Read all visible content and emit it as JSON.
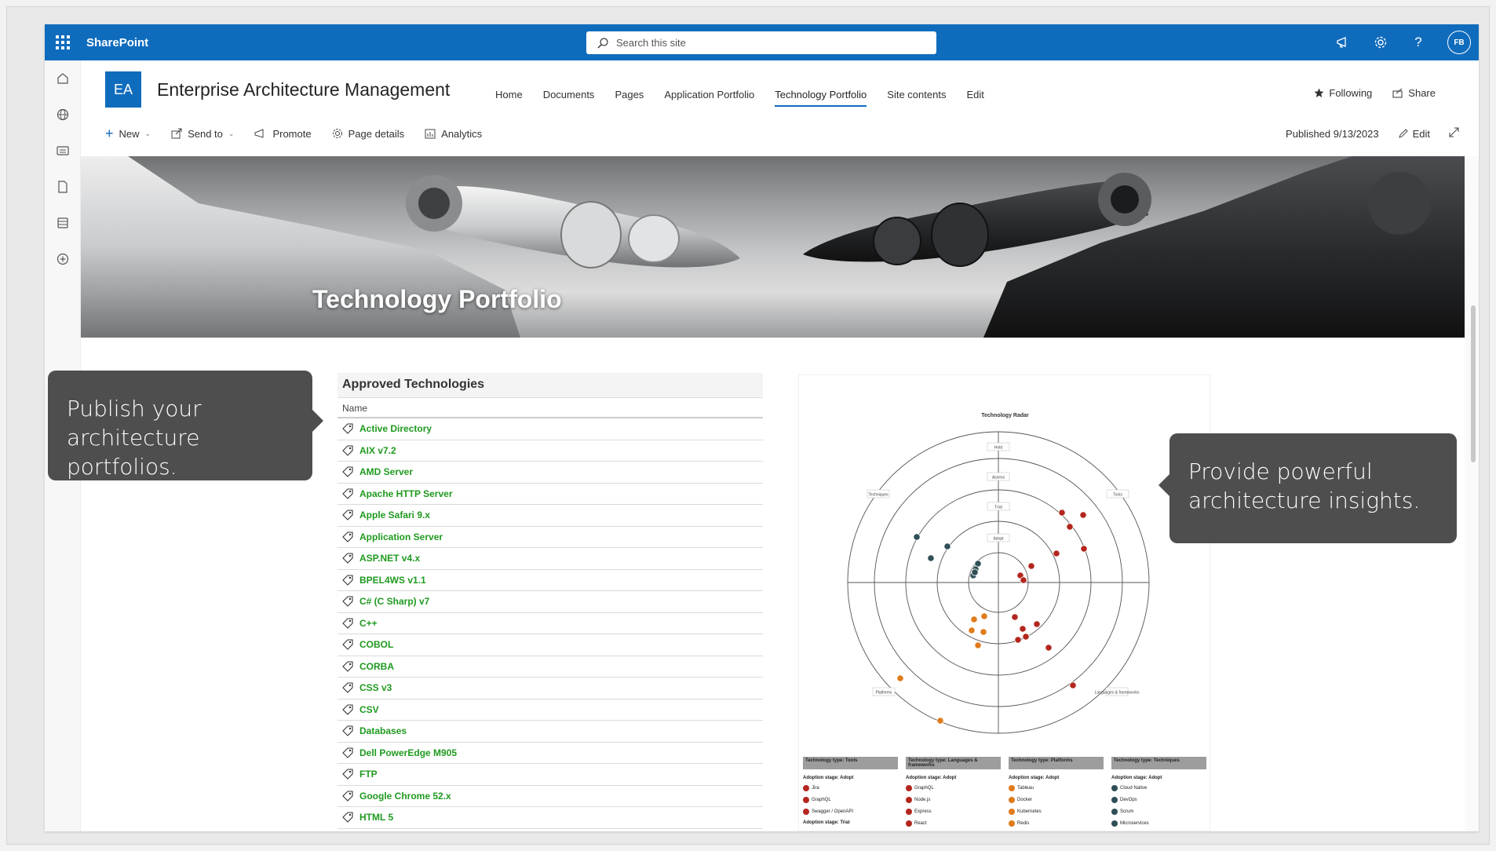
{
  "suite": {
    "brand": "SharePoint",
    "search_placeholder": "Search this site",
    "avatar": "FB"
  },
  "site": {
    "logo": "EA",
    "title": "Enterprise Architecture Management",
    "nav": [
      "Home",
      "Documents",
      "Pages",
      "Application Portfolio",
      "Technology Portfolio",
      "Site contents",
      "Edit"
    ],
    "active_nav": "Technology Portfolio",
    "following": "Following",
    "share": "Share"
  },
  "commandbar": {
    "new": "New",
    "send_to": "Send to",
    "promote": "Promote",
    "page_details": "Page details",
    "analytics": "Analytics",
    "published": "Published 9/13/2023",
    "edit": "Edit"
  },
  "hero": {
    "title": "Technology Portfolio"
  },
  "callouts": {
    "left": [
      "Publish your",
      "architecture portfolios."
    ],
    "right": [
      "Provide powerful",
      "architecture insights."
    ]
  },
  "approved": {
    "title": "Approved Technologies",
    "column": "Name",
    "items": [
      "Active Directory",
      "AIX v7.2",
      "AMD Server",
      "Apache HTTP Server",
      "Apple Safari 9.x",
      "Application Server",
      "ASP.NET v4.x",
      "BPEL4WS v1.1",
      "C# (C Sharp) v7",
      "C++",
      "COBOL",
      "CORBA",
      "CSS v3",
      "CSV",
      "Databases",
      "Dell PowerEdge M905",
      "FTP",
      "Google Chrome 52.x",
      "HTML 5"
    ]
  },
  "radar": {
    "title": "Technology Radar",
    "rings": [
      "Hold",
      "Assess",
      "Trial",
      "Adopt"
    ],
    "quadrants": [
      "Techniques",
      "Tools",
      "Platforms",
      "Languages & frameworks"
    ],
    "colors": {
      "teal": "#2f4f56",
      "red": "#b3261e",
      "orange": "#e07b1c"
    },
    "legend": [
      {
        "head": "Technology type: Tools",
        "stage": "Adoption stage: Adopt",
        "items": [
          "Jira",
          "GraphQL",
          "Swagger / OpenAPI"
        ],
        "color": "#b3261e",
        "footer": "Adoption stage: Trial"
      },
      {
        "head": "Technology type: Languages & frameworks",
        "stage": "Adoption stage: Adopt",
        "items": [
          "GraphQL",
          "Node.js",
          "Express",
          "React"
        ],
        "color": "#b3261e"
      },
      {
        "head": "Technology type: Platforms",
        "stage": "Adoption stage: Adopt",
        "items": [
          "Tableau",
          "Docker",
          "Kubernetes",
          "Redis"
        ],
        "color": "#e07b1c"
      },
      {
        "head": "Technology type: Techniques",
        "stage": "Adoption stage: Adopt",
        "items": [
          "Cloud Native",
          "DevOps",
          "Scrum",
          "Microservices"
        ],
        "color": "#2f4f56"
      }
    ]
  }
}
